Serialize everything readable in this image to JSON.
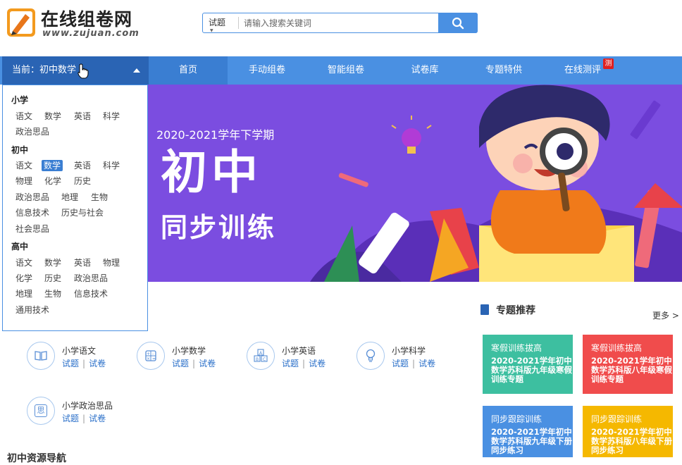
{
  "header": {
    "brand": "在线组卷网",
    "domain": "www.zujuan.com",
    "search": {
      "type": "试题",
      "placeholder": "请输入搜索关键词"
    }
  },
  "nav": {
    "current": "当前：初中数学",
    "items": [
      {
        "label": "首页",
        "active": true
      },
      {
        "label": "手动组卷"
      },
      {
        "label": "智能组卷"
      },
      {
        "label": "试卷库"
      },
      {
        "label": "专题特供"
      },
      {
        "label": "在线测评",
        "badge": "测"
      }
    ]
  },
  "dropdown": {
    "groups": [
      {
        "name": "小学",
        "subjects": [
          "语文",
          "数学",
          "英语",
          "科学",
          "政治思品"
        ]
      },
      {
        "name": "初中",
        "subjects": [
          "语文",
          "数学",
          "英语",
          "科学",
          "物理",
          "化学",
          "历史",
          "政治思品",
          "地理",
          "生物",
          "信息技术",
          "历史与社会",
          "社会思品"
        ],
        "selected": "数学"
      },
      {
        "name": "高中",
        "subjects": [
          "语文",
          "数学",
          "英语",
          "物理",
          "化学",
          "历史",
          "政治思品",
          "地理",
          "生物",
          "信息技术",
          "通用技术"
        ]
      }
    ]
  },
  "banner": {
    "subtitle": "2020-2021学年下学期",
    "title_line1": "初中",
    "title_line2": "同步训练",
    "slides": 5,
    "active_slide": 2
  },
  "subjects": [
    {
      "name": "小学语文",
      "link1": "试题",
      "link2": "试卷",
      "icon": "book-icon"
    },
    {
      "name": "小学数学",
      "link1": "试题",
      "link2": "试卷",
      "icon": "calculator-icon"
    },
    {
      "name": "小学英语",
      "link1": "试题",
      "link2": "试卷",
      "icon": "abc-blocks-icon"
    },
    {
      "name": "小学科学",
      "link1": "试题",
      "link2": "试卷",
      "icon": "lightbulb-icon"
    },
    {
      "name": "小学政治思品",
      "link1": "试题",
      "link2": "试卷",
      "icon": "think-icon",
      "icon_char": "思"
    }
  ],
  "topics": {
    "title": "专题推荐",
    "more": "更多 >",
    "tiles": [
      {
        "category": "寒假训练拔高",
        "title": "2020-2021学年初中数学苏科版九年级寒假训练专题",
        "color": "#3dbfa0"
      },
      {
        "category": "寒假训练拔高",
        "title": "2020-2021学年初中数学苏科版八年级寒假训练专题",
        "color": "#f04c4c"
      },
      {
        "category": "同步跟踪训练",
        "title": "2020-2021学年初中数学苏科版九年级下册同步练习",
        "color": "#4a90e2"
      },
      {
        "category": "同步跟踪训练",
        "title": "2020-2021学年初中数学苏科版八年级下册同步练习",
        "color": "#f5b800"
      }
    ]
  },
  "section_tail": "初中资源导航",
  "colors": {
    "nav": "#4a90e2",
    "nav_current": "#2a64b4",
    "banner": "#7b4de0"
  }
}
